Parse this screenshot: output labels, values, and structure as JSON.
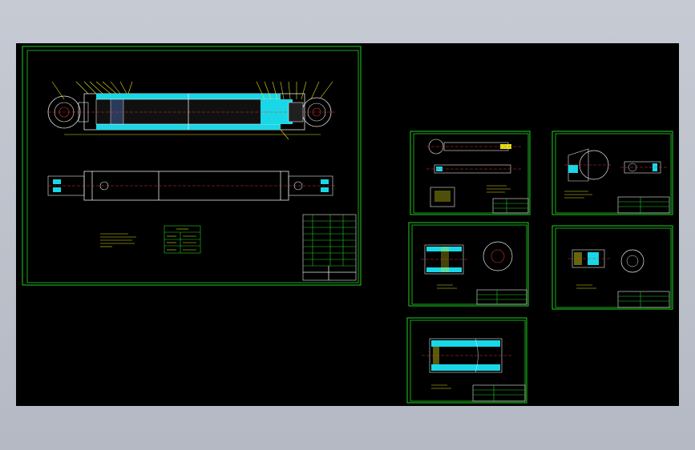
{
  "app": {
    "title": ""
  },
  "drawing": {
    "background": "#000000",
    "frame_color": "#1fd11f",
    "accent_colors": {
      "cyan": "#19d7e6",
      "red": "#e0322e",
      "yellow": "#e3e21a",
      "white": "#e8e8e8"
    },
    "sheets": [
      {
        "id": "assembly",
        "content": "hydraulic-cylinder-assembly"
      },
      {
        "id": "detail-1",
        "content": "piston-rod"
      },
      {
        "id": "detail-2",
        "content": "cylinder-head"
      },
      {
        "id": "detail-3",
        "content": "piston"
      },
      {
        "id": "detail-4",
        "content": "guide-sleeve"
      },
      {
        "id": "detail-5",
        "content": "cylinder-barrel"
      }
    ]
  }
}
